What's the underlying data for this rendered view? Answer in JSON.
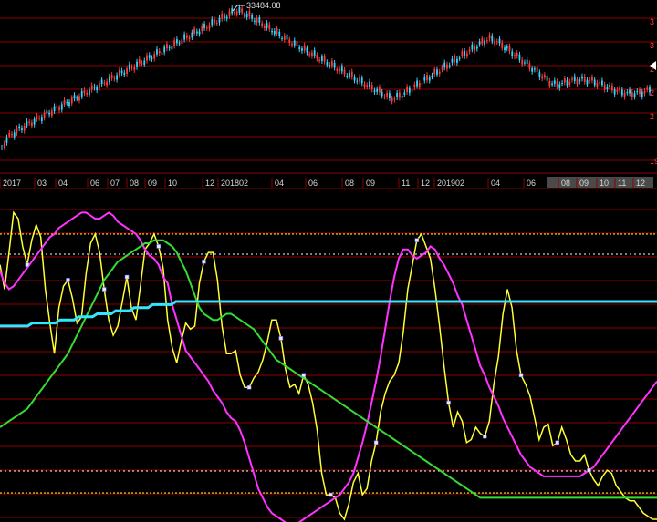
{
  "chart_data": [
    {
      "type": "candlestick",
      "peak_label": "33484.08",
      "x_tick_labels": [
        "2017",
        "03",
        "04",
        "06",
        "07",
        "08",
        "09",
        "10",
        "12",
        "201802",
        "04",
        "06",
        "08",
        "09",
        "11",
        "12",
        "201902",
        "04",
        "06",
        "08",
        "09",
        "10",
        "11",
        "12"
      ],
      "highlighted_ticks": [
        "08",
        "09",
        "10",
        "11",
        "12"
      ],
      "right_axis_labels": [
        "3",
        "3",
        "2",
        "2",
        "2",
        "19"
      ],
      "colors": {
        "up": "#ff3b3b",
        "down": "#33d6ff",
        "grid": "#8b0000",
        "axis_text": "#ff3b3b"
      }
    },
    {
      "type": "line",
      "series": [
        {
          "color": "#ffff33",
          "values": [
            0.78,
            0.7,
            0.82,
            0.95,
            0.93,
            0.84,
            0.78,
            0.86,
            0.91,
            0.87,
            0.7,
            0.59,
            0.49,
            0.64,
            0.71,
            0.73,
            0.67,
            0.59,
            0.61,
            0.75,
            0.85,
            0.88,
            0.82,
            0.7,
            0.6,
            0.55,
            0.58,
            0.66,
            0.74,
            0.64,
            0.6,
            0.71,
            0.83,
            0.85,
            0.88,
            0.84,
            0.77,
            0.6,
            0.51,
            0.46,
            0.53,
            0.59,
            0.57,
            0.58,
            0.72,
            0.79,
            0.82,
            0.82,
            0.73,
            0.58,
            0.49,
            0.49,
            0.5,
            0.42,
            0.38,
            0.38,
            0.41,
            0.43,
            0.47,
            0.53,
            0.6,
            0.6,
            0.54,
            0.44,
            0.38,
            0.39,
            0.36,
            0.42,
            0.39,
            0.33,
            0.24,
            0.1,
            0.03,
            0.03,
            0.02,
            -0.03,
            -0.05,
            0.0,
            0.07,
            0.1,
            0.03,
            0.05,
            0.14,
            0.2,
            0.3,
            0.36,
            0.4,
            0.42,
            0.46,
            0.56,
            0.7,
            0.78,
            0.86,
            0.88,
            0.84,
            0.8,
            0.7,
            0.58,
            0.45,
            0.33,
            0.25,
            0.3,
            0.27,
            0.2,
            0.21,
            0.25,
            0.23,
            0.22,
            0.27,
            0.39,
            0.48,
            0.62,
            0.7,
            0.64,
            0.5,
            0.42,
            0.39,
            0.35,
            0.28,
            0.21,
            0.25,
            0.26,
            0.19,
            0.2,
            0.25,
            0.21,
            0.16,
            0.14,
            0.14,
            0.16,
            0.11,
            0.08,
            0.06,
            0.09,
            0.11,
            0.1,
            0.06,
            0.04,
            0.02,
            0.01,
            0.01,
            -0.01,
            -0.03,
            -0.04,
            -0.05,
            -0.05
          ]
        },
        {
          "color": "#ff33ff",
          "values": [
            0.76,
            0.72,
            0.7,
            0.71,
            0.73,
            0.75,
            0.77,
            0.79,
            0.81,
            0.83,
            0.85,
            0.87,
            0.88,
            0.9,
            0.91,
            0.92,
            0.93,
            0.94,
            0.95,
            0.95,
            0.94,
            0.93,
            0.93,
            0.94,
            0.95,
            0.94,
            0.92,
            0.91,
            0.9,
            0.89,
            0.88,
            0.86,
            0.83,
            0.81,
            0.8,
            0.78,
            0.74,
            0.72,
            0.65,
            0.6,
            0.55,
            0.5,
            0.48,
            0.46,
            0.44,
            0.42,
            0.4,
            0.37,
            0.35,
            0.33,
            0.3,
            0.28,
            0.27,
            0.24,
            0.2,
            0.15,
            0.1,
            0.05,
            0.02,
            -0.01,
            -0.03,
            -0.04,
            -0.05,
            -0.06,
            -0.07,
            -0.07,
            -0.06,
            -0.05,
            -0.04,
            -0.03,
            -0.02,
            -0.01,
            0.0,
            0.01,
            0.02,
            0.03,
            0.05,
            0.07,
            0.1,
            0.15,
            0.2,
            0.26,
            0.33,
            0.4,
            0.48,
            0.57,
            0.66,
            0.74,
            0.8,
            0.83,
            0.83,
            0.81,
            0.8,
            0.81,
            0.82,
            0.84,
            0.83,
            0.8,
            0.78,
            0.75,
            0.72,
            0.68,
            0.65,
            0.6,
            0.55,
            0.5,
            0.45,
            0.42,
            0.38,
            0.35,
            0.32,
            0.28,
            0.25,
            0.22,
            0.19,
            0.16,
            0.14,
            0.12,
            0.11,
            0.1,
            0.09,
            0.09,
            0.09,
            0.09,
            0.09,
            0.09,
            0.09,
            0.09,
            0.09,
            0.1,
            0.11,
            0.12,
            0.14,
            0.16,
            0.18,
            0.2,
            0.22,
            0.24,
            0.26,
            0.28,
            0.3,
            0.32,
            0.34,
            0.36,
            0.38,
            0.4
          ]
        },
        {
          "color": "#33dd33",
          "values": [
            0.25,
            0.26,
            0.27,
            0.28,
            0.29,
            0.3,
            0.31,
            0.33,
            0.35,
            0.37,
            0.39,
            0.41,
            0.43,
            0.45,
            0.47,
            0.49,
            0.52,
            0.55,
            0.58,
            0.61,
            0.64,
            0.67,
            0.7,
            0.73,
            0.75,
            0.77,
            0.79,
            0.8,
            0.81,
            0.82,
            0.83,
            0.84,
            0.85,
            0.85,
            0.86,
            0.86,
            0.86,
            0.85,
            0.84,
            0.82,
            0.79,
            0.76,
            0.72,
            0.68,
            0.64,
            0.62,
            0.61,
            0.6,
            0.6,
            0.61,
            0.62,
            0.62,
            0.61,
            0.6,
            0.59,
            0.58,
            0.57,
            0.55,
            0.53,
            0.51,
            0.49,
            0.47,
            0.46,
            0.45,
            0.44,
            0.43,
            0.42,
            0.41,
            0.4,
            0.39,
            0.38,
            0.37,
            0.36,
            0.35,
            0.34,
            0.33,
            0.32,
            0.31,
            0.3,
            0.29,
            0.28,
            0.27,
            0.26,
            0.25,
            0.24,
            0.23,
            0.22,
            0.21,
            0.2,
            0.19,
            0.18,
            0.17,
            0.16,
            0.15,
            0.14,
            0.13,
            0.12,
            0.11,
            0.1,
            0.09,
            0.08,
            0.07,
            0.06,
            0.05,
            0.04,
            0.03,
            0.02,
            0.02,
            0.02,
            0.02,
            0.02,
            0.02,
            0.02,
            0.02,
            0.02,
            0.02,
            0.02,
            0.02,
            0.02,
            0.02,
            0.02,
            0.02,
            0.02,
            0.02,
            0.02,
            0.02,
            0.02,
            0.02,
            0.02,
            0.02,
            0.02,
            0.02,
            0.02,
            0.02,
            0.02,
            0.02,
            0.02,
            0.02,
            0.02,
            0.02,
            0.02,
            0.02,
            0.02,
            0.02,
            0.02,
            0.02
          ]
        },
        {
          "color": "#33e6ff",
          "values": [
            0.58,
            0.58,
            0.58,
            0.58,
            0.58,
            0.58,
            0.58,
            0.59,
            0.59,
            0.59,
            0.59,
            0.59,
            0.59,
            0.6,
            0.6,
            0.6,
            0.6,
            0.61,
            0.61,
            0.61,
            0.61,
            0.62,
            0.62,
            0.62,
            0.62,
            0.63,
            0.63,
            0.63,
            0.63,
            0.64,
            0.64,
            0.64,
            0.64,
            0.65,
            0.65,
            0.65,
            0.65,
            0.65,
            0.66,
            0.66,
            0.66,
            0.66,
            0.66,
            0.66,
            0.66,
            0.66,
            0.66,
            0.66,
            0.66,
            0.66,
            0.66,
            0.66,
            0.66,
            0.66,
            0.66,
            0.66,
            0.66,
            0.66,
            0.66,
            0.66,
            0.66,
            0.66,
            0.66,
            0.66,
            0.66,
            0.66,
            0.66,
            0.66,
            0.66,
            0.66,
            0.66,
            0.66,
            0.66,
            0.66,
            0.66,
            0.66,
            0.66,
            0.66,
            0.66,
            0.66,
            0.66,
            0.66,
            0.66,
            0.66,
            0.66,
            0.66,
            0.66,
            0.66,
            0.66,
            0.66,
            0.66,
            0.66,
            0.66,
            0.66,
            0.66,
            0.66,
            0.66,
            0.66,
            0.66,
            0.66,
            0.66,
            0.66,
            0.66,
            0.66,
            0.66,
            0.66,
            0.66,
            0.66,
            0.66,
            0.66,
            0.66,
            0.66,
            0.66,
            0.66,
            0.66,
            0.66,
            0.66,
            0.66,
            0.66,
            0.66,
            0.66,
            0.66,
            0.66,
            0.66,
            0.66,
            0.66,
            0.66,
            0.66,
            0.66,
            0.66,
            0.66,
            0.66,
            0.66,
            0.66,
            0.66,
            0.66,
            0.66,
            0.66,
            0.66,
            0.66,
            0.66,
            0.66,
            0.66
          ]
        }
      ]
    }
  ]
}
